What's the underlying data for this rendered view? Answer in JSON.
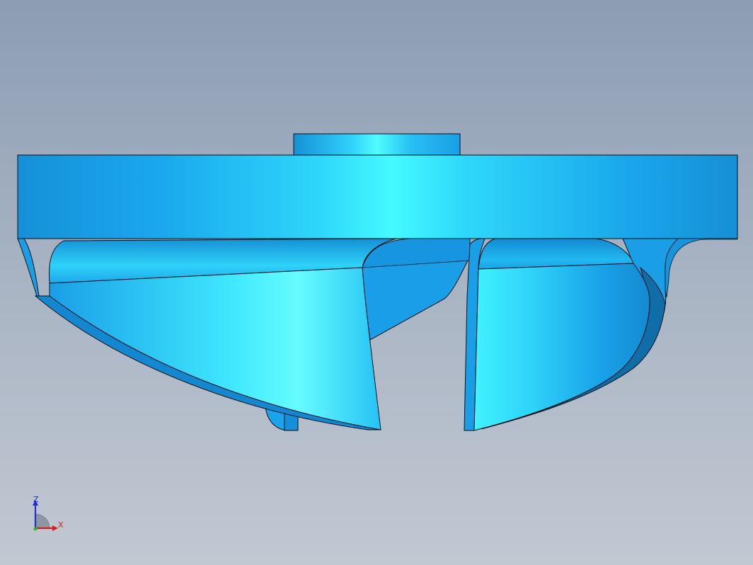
{
  "view": {
    "background_top": "#8c9db4",
    "background_bottom": "#c2c8d2",
    "model_color": "#1aa6ec",
    "highlight_color": "#3ff4ff",
    "edge_color": "#05121c"
  },
  "triad": {
    "z_label": "Z",
    "x_label": "X",
    "z_color": "#1e2fd0",
    "x_color": "#d01e1e"
  }
}
